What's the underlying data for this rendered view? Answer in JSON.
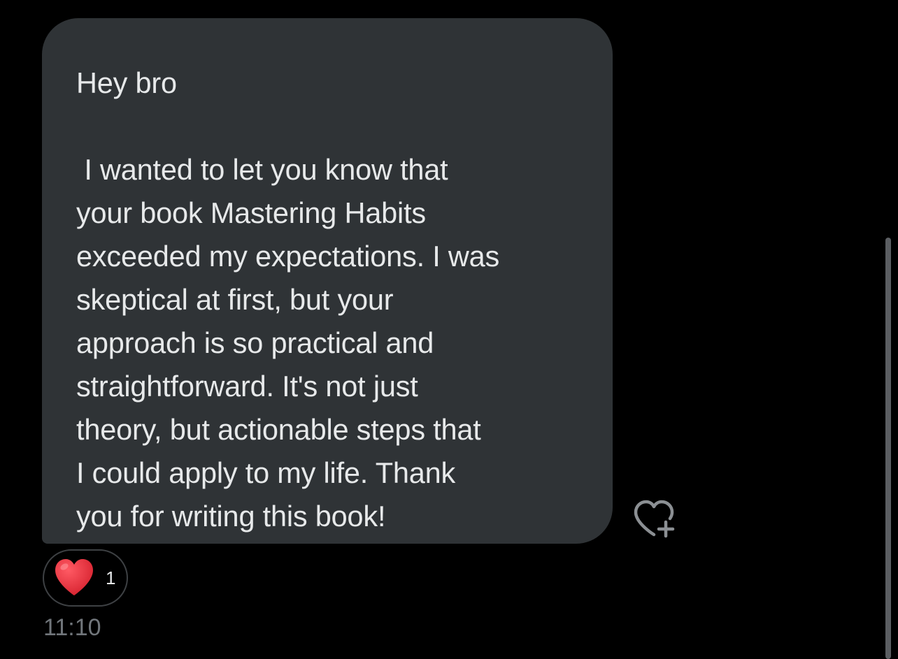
{
  "message": {
    "greeting": "Hey bro",
    "body_lines": [
      " I wanted to let you know that",
      "your book Mastering Habits",
      "exceeded my expectations. I was",
      "skeptical at first, but your",
      "approach is so practical and",
      "straightforward. It's not just",
      "theory, but actionable steps that",
      "I could apply to my life. Thank",
      "you for writing this book!"
    ],
    "timestamp": "11:10"
  },
  "reactions": {
    "items": [
      {
        "icon": "heart-emoji-icon",
        "count": "1"
      }
    ]
  },
  "controls": {
    "add_reaction_icon": "heart-plus-icon"
  },
  "colors": {
    "background": "#000000",
    "bubble": "#2f3336",
    "text": "#e7e9ea",
    "muted": "#71767b",
    "heart": "#e0303d"
  }
}
